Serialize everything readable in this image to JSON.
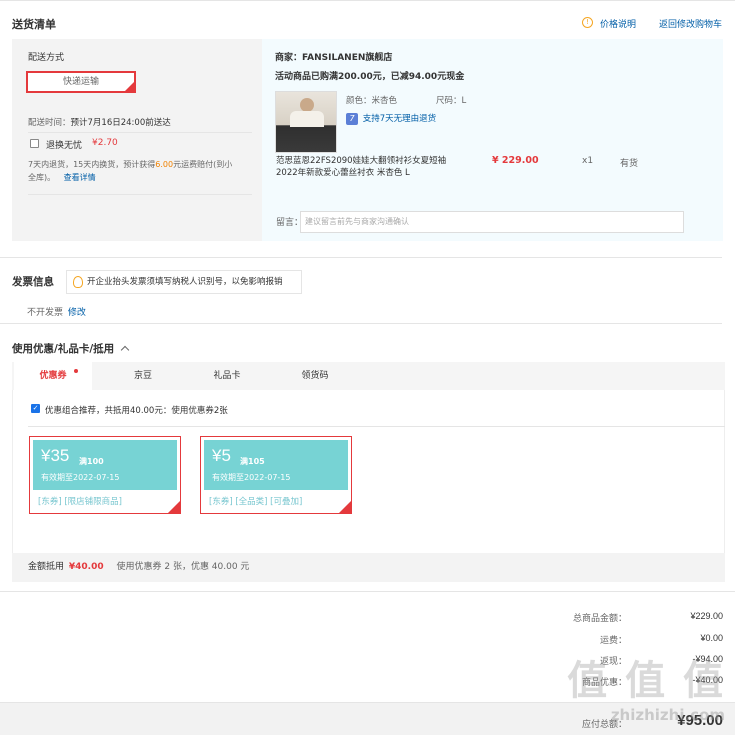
{
  "delivery": {
    "title": "送货清单",
    "price_note": "价格说明",
    "back_link": "返回修改购物车",
    "method_label": "配送方式",
    "method_value": "快递运输",
    "time_label": "配送时间：",
    "time_value": "预计7月16日24:00前送达",
    "return_option": "退换无忧",
    "return_price": "¥2.70",
    "return_desc_1": "7天内退货，15天内换货，预计获得",
    "return_desc_amount": "6.00",
    "return_desc_2": "元运费赔付(到小",
    "return_desc_3": "全库)。",
    "return_details_link": "查看详情"
  },
  "shop": {
    "name_label": "商家：",
    "name": "FANSILANEN旗舰店",
    "promo": "活动商品已购满200.00元，已减94.00元现金",
    "color_label": "颜色：",
    "color_value": "米杏色",
    "size_label": "尺码：",
    "size_value": "L",
    "return_badge": "7",
    "return_support": "支持7天无理由退货",
    "product_title_1": "范思蓝恩22FS2090娃娃大翻领衬衫女夏短袖",
    "product_title_2": "2022年新款爱心蕾丝衬衣 米杏色 L",
    "price": "¥ 229.00",
    "qty": "x1",
    "stock": "有货",
    "remark_label": "留言：",
    "remark_placeholder": "建议留言前先与商家沟通确认"
  },
  "invoice": {
    "title": "发票信息",
    "tip": "开企业抬头发票须填写纳税人识别号，以免影响报销",
    "status": "不开发票",
    "edit_link": "修改"
  },
  "coupons": {
    "title": "使用优惠/礼品卡/抵用",
    "tabs": [
      "优惠券",
      "京豆",
      "礼品卡",
      "领货码"
    ],
    "combo_text": "优惠组合推荐，共抵用40.00元：使用优惠券2张",
    "items": [
      {
        "amount": "¥35",
        "condition": "满100",
        "valid": "有效期至2022-07-15",
        "tags": "[东券] [限店铺限商品]"
      },
      {
        "amount": "¥5",
        "condition": "满105",
        "valid": "有效期至2022-07-15",
        "tags": "[东券] [全品类] [可叠加]"
      }
    ],
    "deduct_label": "金额抵用",
    "deduct_amount": "¥40.00",
    "deduct_desc": "使用优惠券 2 张，优惠 40.00 元"
  },
  "summary": {
    "rows": [
      {
        "label": "总商品金额：",
        "value": "¥229.00"
      },
      {
        "label": "运费：",
        "value": "¥0.00"
      },
      {
        "label": "返现：",
        "value": "-¥94.00"
      },
      {
        "label": "商品优惠：",
        "value": "-¥40.00"
      }
    ],
    "total_label": "应付总额：",
    "total_value": "¥95.00"
  },
  "watermark": {
    "main": "值 值 值",
    "sub": "zhizhizhi.com"
  },
  "colors": {
    "accent": "#e4393c",
    "coupon": "#77d3d4",
    "link": "#005ea7"
  }
}
